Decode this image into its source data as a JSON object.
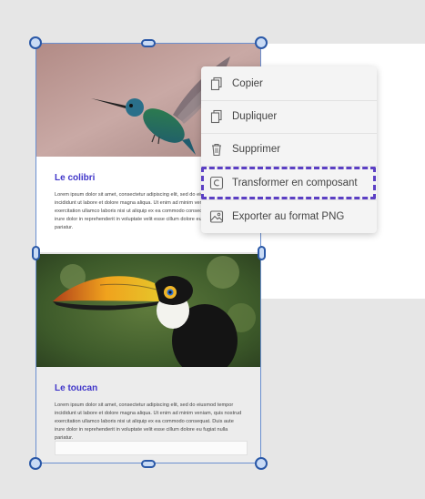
{
  "cards": [
    {
      "title": "Le colibri",
      "body": "Lorem ipsum dolor sit amet, consectetur adipiscing elit, sed do eiusmod tempor incididunt ut labore et dolore magna aliqua. Ut enim ad minim veniam, quis nostrud exercitation ullamco laboris nisi ut aliquip ex ea commodo consequat. Duis aute irure dolor in reprehenderit in voluptate velit esse cillum dolore eu fugiat nulla pariatur.",
      "image_name": "hummingbird-photo"
    },
    {
      "title": "Le toucan",
      "body": "Lorem ipsum dolor sit amet, consectetur adipiscing elit, sed do eiusmod tempor incididunt ut labore et dolore magna aliqua. Ut enim ad minim veniam, quis nostrud exercitation ullamco laboris nisi ut aliquip ex ea commodo consequat. Duis aute irure dolor in reprehenderit in voluptate velit esse cillum dolore eu fugiat nulla pariatur.",
      "image_name": "toucan-photo"
    }
  ],
  "context_menu": {
    "items": [
      {
        "label": "Copier",
        "icon": "copy-icon"
      },
      {
        "label": "Dupliquer",
        "icon": "duplicate-icon"
      },
      {
        "label": "Supprimer",
        "icon": "trash-icon"
      },
      {
        "label": "Transformer en composant",
        "icon": "component-icon",
        "highlighted": true
      },
      {
        "label": "Exporter au format PNG",
        "icon": "image-icon"
      }
    ]
  },
  "colors": {
    "accent": "#3f35c9",
    "selection": "#2a58a7",
    "highlight_dashed": "#5b3fc4"
  }
}
